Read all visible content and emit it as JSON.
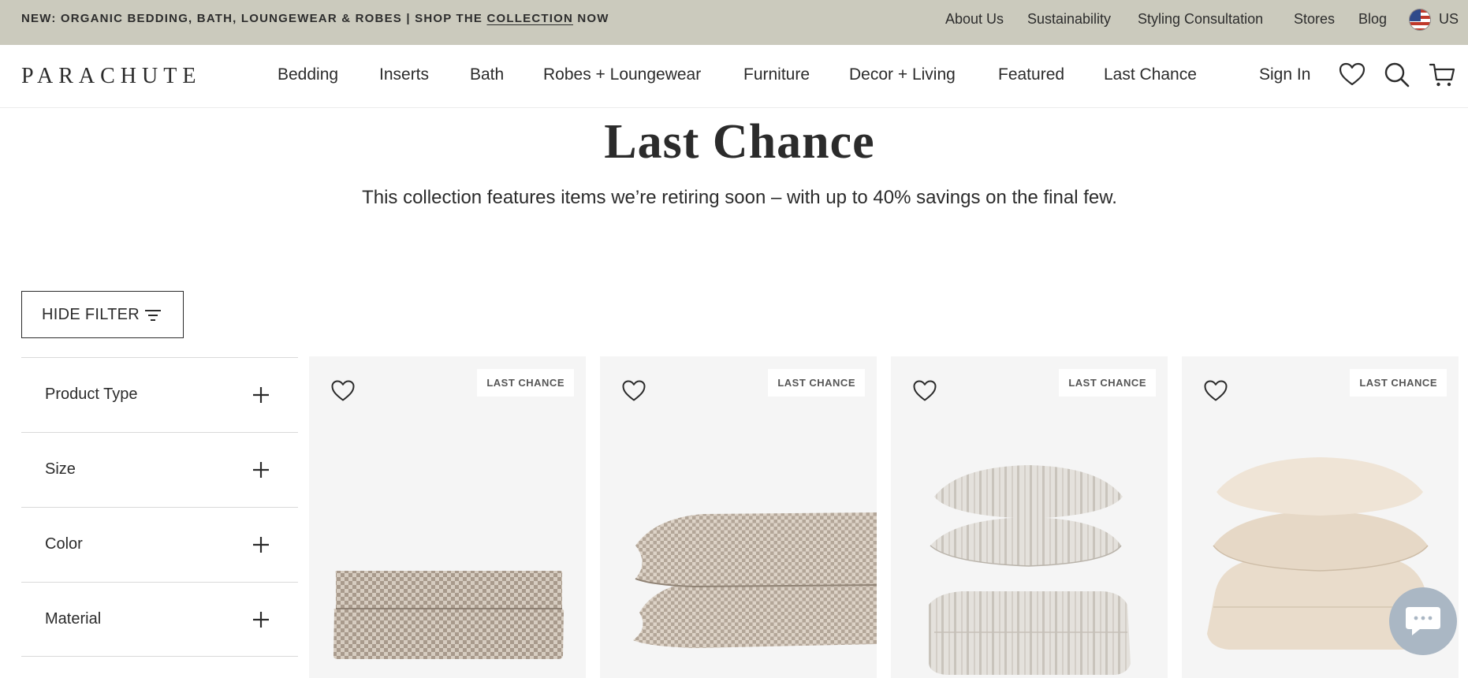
{
  "announcement": {
    "text_before": "NEW: ORGANIC BEDDING, BATH, LOUNGEWEAR & ROBES | SHOP THE ",
    "link": "COLLECTION",
    "text_after": " NOW"
  },
  "utility_nav": [
    "About Us",
    "Sustainability",
    "Styling Consultation",
    "Stores",
    "Blog"
  ],
  "region": "US",
  "logo": "PARACHUTE",
  "main_nav": [
    "Bedding",
    "Inserts",
    "Bath",
    "Robes + Loungewear",
    "Furniture",
    "Decor + Living",
    "Featured",
    "Last Chance"
  ],
  "sign_in": "Sign In",
  "icons": {
    "wishlist": "heart-icon",
    "search": "search-icon",
    "cart": "cart-icon",
    "filter": "filter-icon",
    "expand": "plus-icon",
    "chat": "chat-icon",
    "flag": "us-flag-icon"
  },
  "page": {
    "title": "Last Chance",
    "subtitle": "This collection features items we’re retiring soon – with up to 40% savings on the final few."
  },
  "filter_button": "HIDE FILTER",
  "filters": [
    "Product Type",
    "Size",
    "Color",
    "Material"
  ],
  "products": [
    {
      "badge": "LAST CHANCE",
      "image": "folded-checkered-sheets"
    },
    {
      "badge": "LAST CHANCE",
      "image": "stacked-checkered-pillows"
    },
    {
      "badge": "LAST CHANCE",
      "image": "striped-linen-bedding-stack"
    },
    {
      "badge": "LAST CHANCE",
      "image": "cream-linen-bedding-stack"
    }
  ],
  "colors": {
    "announcement_bg": "#cbcabd",
    "card_bg": "#f5f5f5",
    "text": "#2b2b2b",
    "chat_bg": "#aab7c4"
  }
}
